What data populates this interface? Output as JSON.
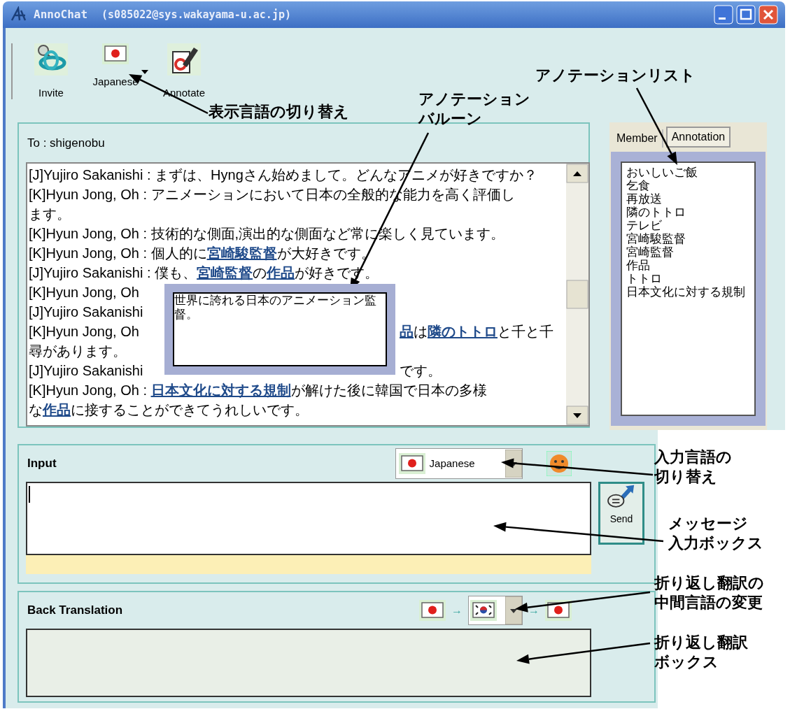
{
  "window": {
    "title": "AnnoChat",
    "account": "(s085022@sys.wakayama-u.ac.jp)"
  },
  "toolbar": [
    {
      "kind": "invite",
      "label": "Invite",
      "dropdown": false
    },
    {
      "kind": "flag_jp",
      "label": "Japanese",
      "dropdown": true
    },
    {
      "kind": "annotate",
      "label": "Annotate",
      "dropdown": false
    }
  ],
  "chat": {
    "to": "To : shigenobu",
    "messages": [
      {
        "speaker": "[J]Yujiro Sakanishi :",
        "covered": false,
        "lines": [
          [
            {
              "text": "まずは、Hyngさん始めまして。どんなアニメが好きですか？"
            }
          ]
        ]
      },
      {
        "speaker": "[K]Hyun Jong, Oh :",
        "covered": false,
        "lines": [
          [
            {
              "text": "アニメーションにおいて日本の全般的な能力を高く評価し"
            }
          ],
          [
            {
              "text": "ます。"
            }
          ]
        ]
      },
      {
        "speaker": "[K]Hyun Jong, Oh :",
        "covered": false,
        "lines": [
          [
            {
              "text": "技術的な側面,演出的な側面など常に楽しく見ています。"
            }
          ]
        ]
      },
      {
        "speaker": "[K]Hyun Jong, Oh :",
        "covered": false,
        "lines": [
          [
            {
              "text": "個人的に"
            },
            {
              "text": "宮崎駿監督",
              "link": true
            },
            {
              "text": "が大好きです。"
            }
          ]
        ]
      },
      {
        "speaker": "[J]Yujiro Sakanishi :",
        "covered": false,
        "lines": [
          [
            {
              "text": "僕も、"
            },
            {
              "text": "宮崎監督",
              "link": true
            },
            {
              "text": "の"
            },
            {
              "text": "作品",
              "link": true
            },
            {
              "text": "が好きです。"
            }
          ]
        ]
      },
      {
        "speaker": "[K]Hyun Jong, Oh",
        "covered": true
      },
      {
        "speaker": "[J]Yujiro Sakanishi",
        "covered": true
      },
      {
        "speaker": "[K]Hyun Jong, Oh",
        "covered": true,
        "lines": [
          [
            {
              "text": "品",
              "link": true
            },
            {
              "text": "は"
            },
            {
              "text": "隣のトトロ",
              "link": true
            },
            {
              "text": "と千と千"
            }
          ],
          [
            {
              "text": "尋があります。"
            }
          ]
        ]
      },
      {
        "speaker": "[J]Yujiro Sakanishi",
        "covered": true,
        "lines": [
          [
            {
              "text": "です。"
            }
          ]
        ]
      },
      {
        "speaker": "[K]Hyun Jong, Oh :",
        "covered": false,
        "lines": [
          [
            {
              "text": "日本文化に対する規制",
              "link": true
            },
            {
              "text": "が解けた後に韓国で日本の多様"
            }
          ],
          [
            {
              "text": "な"
            },
            {
              "text": "作品",
              "link": true
            },
            {
              "text": "に接することができてうれしいです。"
            }
          ]
        ]
      }
    ]
  },
  "balloon": {
    "text": "世界に誇れる日本のアニメーション監督。"
  },
  "side_tabs": [
    {
      "label": "Member",
      "selected": false
    },
    {
      "label": "Annotation",
      "selected": true
    }
  ],
  "annotation_list": [
    "おいしいご飯",
    "乞食",
    "再放送",
    "隣のトトロ",
    "テレビ",
    "宮崎駿監督",
    "宮崎監督",
    "作品",
    "トトロ",
    "日本文化に対する規制"
  ],
  "input": {
    "title": "Input",
    "language": {
      "kind": "jp",
      "label": "Japanese"
    },
    "send": "Send"
  },
  "back_translation": {
    "title": "Back Translation",
    "path": [
      {
        "kind": "jp",
        "dropdown": false
      },
      {
        "arrow": "→",
        "kind": "kr",
        "dropdown": true
      },
      {
        "arrow": "→",
        "kind": "jp",
        "dropdown": false
      }
    ]
  },
  "callouts": [
    {
      "lines": [
        "表示言語の切り替え"
      ]
    },
    {
      "lines": [
        "アノテーション",
        "バルーン"
      ]
    },
    {
      "lines": [
        "アノテーションリスト"
      ]
    },
    {
      "lines": [
        "入力言語の",
        "切り替え"
      ]
    },
    {
      "lines": [
        "メッセージ",
        "入力ボックス"
      ]
    },
    {
      "lines": [
        "折り返し翻訳の",
        "中間言語の変更"
      ]
    },
    {
      "lines": [
        "折り返し翻訳",
        "ボックス"
      ]
    }
  ]
}
